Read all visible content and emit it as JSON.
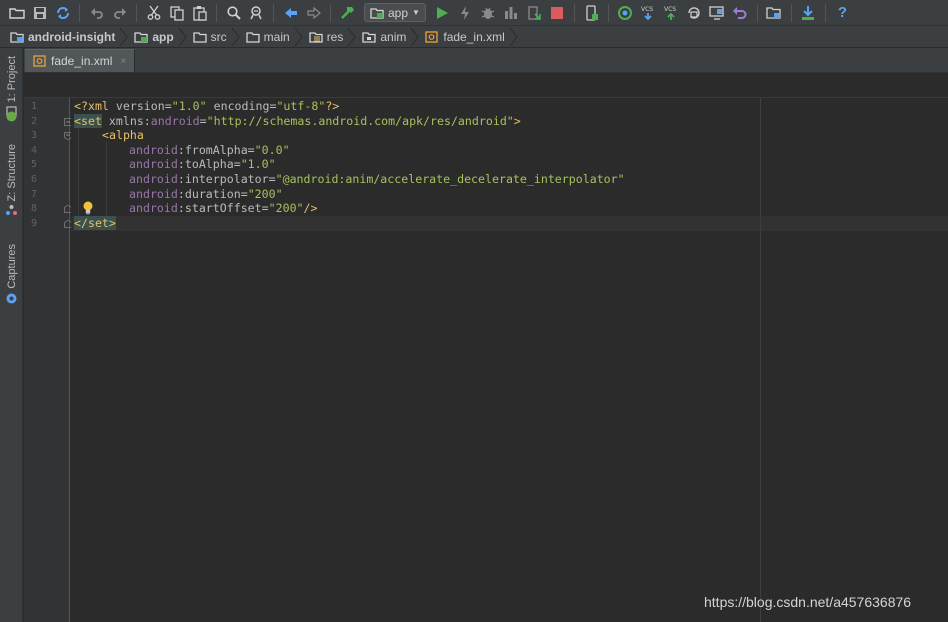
{
  "toolbar": {
    "run_config": "app",
    "buttons": [
      "open-icon",
      "save-icon",
      "sync-icon",
      "undo-icon",
      "redo-icon",
      "cut-icon",
      "copy-icon",
      "paste-icon",
      "find-icon",
      "replace-icon",
      "back-icon",
      "forward-icon",
      "make-project-icon",
      "run-icon",
      "apply-changes-icon",
      "debug-icon",
      "profile-icon",
      "attach-debugger-icon",
      "stop-icon",
      "avd-manager-icon",
      "sync-gradle-icon",
      "vcs-update-icon",
      "vcs-commit-icon",
      "vcs-history-icon",
      "device-monitor-icon",
      "revert-icon",
      "project-structure-icon",
      "sdk-manager-icon",
      "help-icon"
    ],
    "vcs_label": "VCS",
    "help_label": "?"
  },
  "breadcrumb": [
    {
      "label": "android-insight",
      "icon": "project-folder-icon"
    },
    {
      "label": "app",
      "icon": "module-folder-icon"
    },
    {
      "label": "src",
      "icon": "folder-icon"
    },
    {
      "label": "main",
      "icon": "folder-icon"
    },
    {
      "label": "res",
      "icon": "resource-folder-icon"
    },
    {
      "label": "anim",
      "icon": "resource-dir-icon"
    },
    {
      "label": "fade_in.xml",
      "icon": "xml-file-icon"
    }
  ],
  "side_tabs": {
    "project": "1: Project",
    "structure": "Z: Structure",
    "captures": "Captures"
  },
  "editor_tab": {
    "label": "fade_in.xml",
    "close": "×"
  },
  "line_numbers": [
    "1",
    "2",
    "3",
    "4",
    "5",
    "6",
    "7",
    "8",
    "9"
  ],
  "code": {
    "l1": {
      "a": "<?xml ",
      "b": "version=",
      "c": "\"1.0\"",
      "d": " encoding=",
      "e": "\"utf-8\"",
      "f": "?>"
    },
    "l2": {
      "a": "<set",
      "b": " xmlns:",
      "c": "android",
      "d": "=",
      "e": "\"http://schemas.android.com/apk/res/android\"",
      "f": ">"
    },
    "l3": {
      "a": "<alpha"
    },
    "l4": {
      "a": "android",
      "b": ":fromAlpha=",
      "c": "\"0.0\""
    },
    "l5": {
      "a": "android",
      "b": ":toAlpha=",
      "c": "\"1.0\""
    },
    "l6": {
      "a": "android",
      "b": ":interpolator=",
      "c": "\"@android:anim/accelerate_decelerate_interpolator\""
    },
    "l7": {
      "a": "android",
      "b": ":duration=",
      "c": "\"200\""
    },
    "l8": {
      "a": "android",
      "b": ":startOffset=",
      "c": "\"200\"",
      "d": "/>"
    },
    "l9": {
      "a": "</set>"
    }
  },
  "watermark": "https://blog.csdn.net/a457636876",
  "colors": {
    "background": "#2b2b2b",
    "toolbar": "#3c3f41",
    "xml_tag": "#e8bf6a",
    "xml_string": "#a5c25c",
    "xml_namespace": "#9876aa",
    "text": "#bababa",
    "run_green": "#4caf50",
    "stop_red": "#db5c5c"
  }
}
